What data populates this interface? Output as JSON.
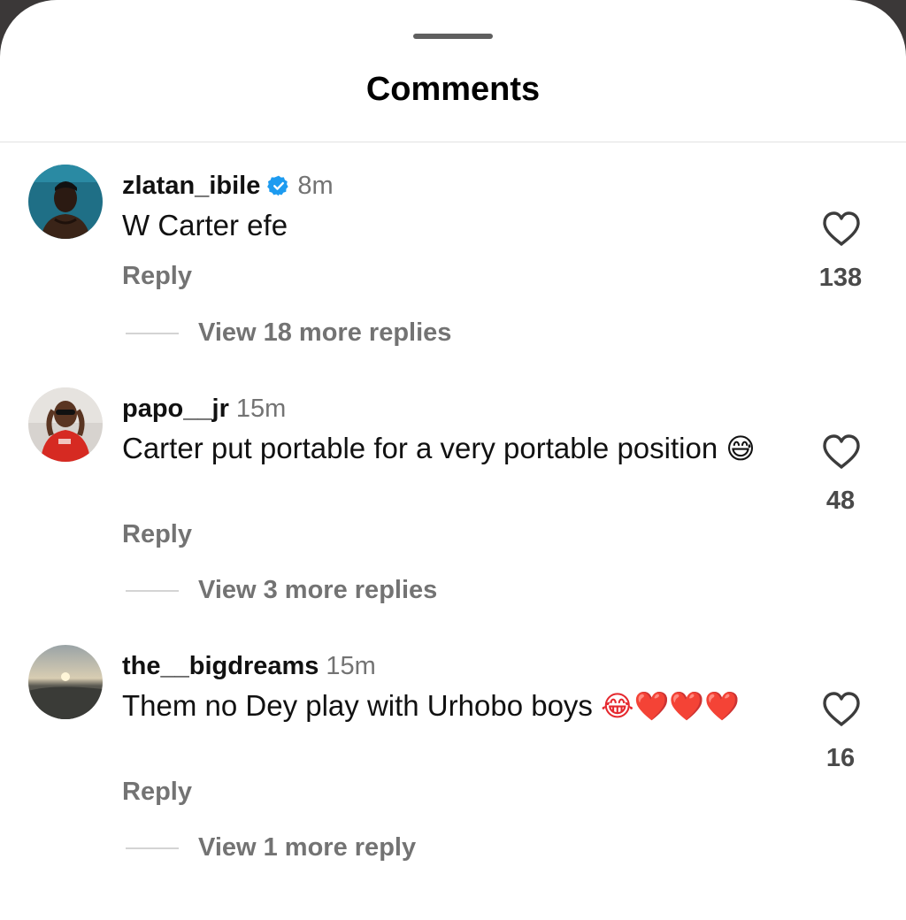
{
  "sheet": {
    "title": "Comments"
  },
  "comments": [
    {
      "username": "zlatan_ibile",
      "verified": true,
      "time": "8m",
      "text": "W Carter efe",
      "emoji": "",
      "reply_label": "Reply",
      "likes": "138",
      "view_more": "View 18 more replies"
    },
    {
      "username": "papo__jr",
      "verified": false,
      "time": "15m",
      "text": "Carter put portable for a very portable position",
      "emoji": "😅",
      "reply_label": "Reply",
      "likes": "48",
      "view_more": "View 3 more replies"
    },
    {
      "username": "the__bigdreams",
      "verified": false,
      "time": "15m",
      "text": "Them no Dey play with Urhobo boys",
      "emoji": "😂❤️❤️❤️",
      "reply_label": "Reply",
      "likes": "16",
      "view_more": "View 1 more reply"
    }
  ],
  "colors": {
    "verified_badge": "#1d9bf0",
    "secondary_text": "#737373",
    "heart_outline": "#3c3c3c"
  },
  "icons": {
    "like": "heart-outline-icon",
    "verified": "verified-badge-icon"
  }
}
